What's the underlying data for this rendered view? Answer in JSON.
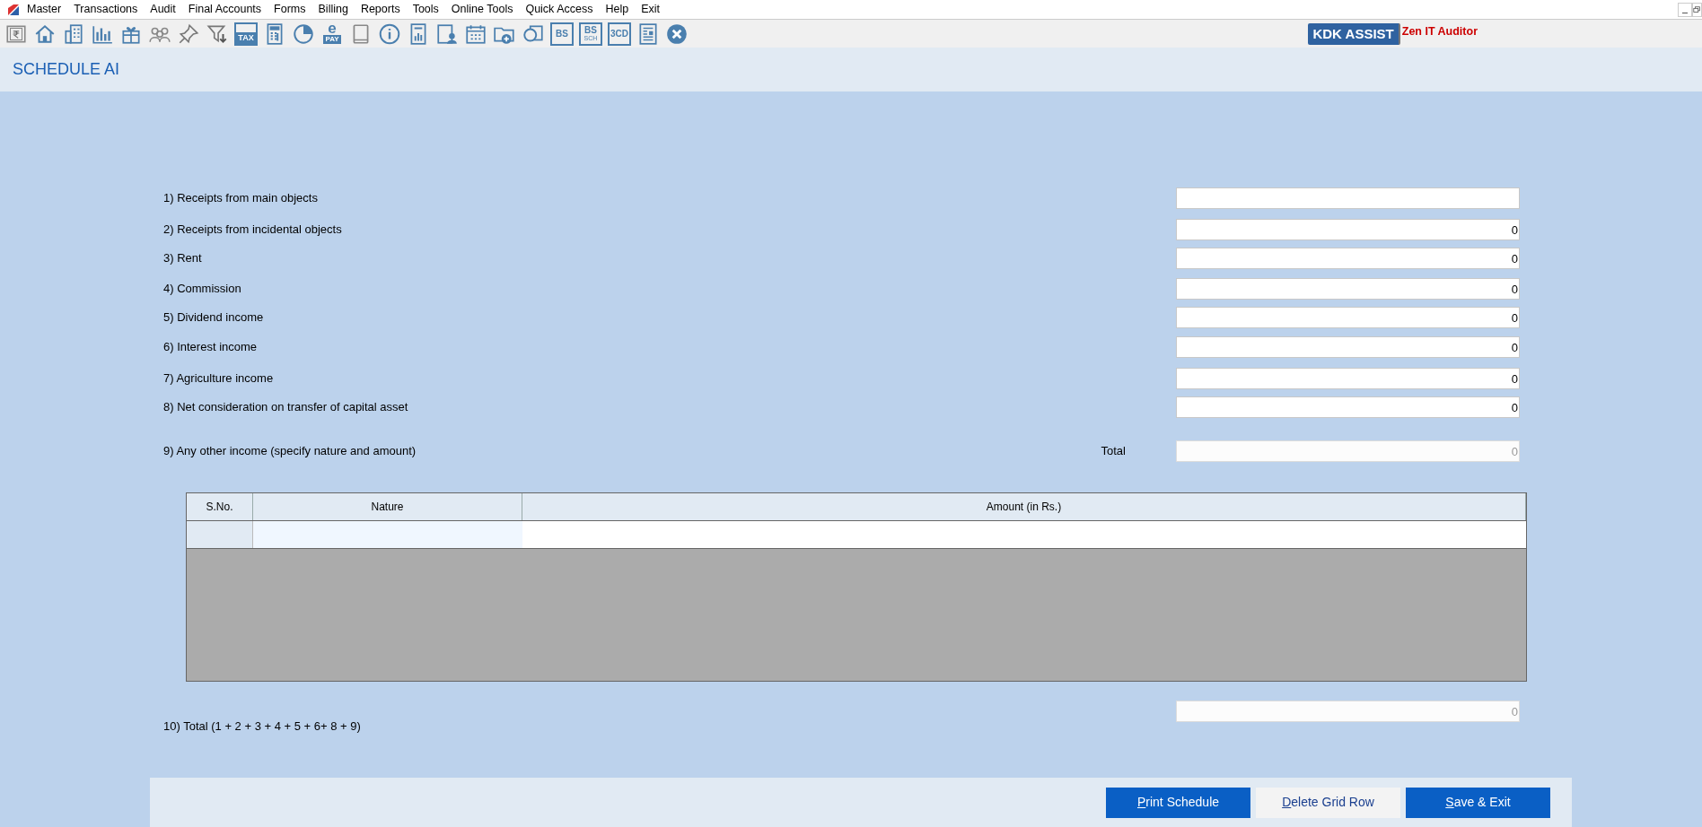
{
  "menu": [
    "Master",
    "Transactions",
    "Audit",
    "Final Accounts",
    "Forms",
    "Billing",
    "Reports",
    "Tools",
    "Online Tools",
    "Quick Access",
    "Help",
    "Exit"
  ],
  "toolbar": [
    {
      "kind": "rupee"
    },
    {
      "kind": "home"
    },
    {
      "kind": "building"
    },
    {
      "kind": "barchart"
    },
    {
      "kind": "gift"
    },
    {
      "kind": "people"
    },
    {
      "kind": "pin"
    },
    {
      "kind": "filter"
    },
    {
      "kind": "tax",
      "label": "TAX"
    },
    {
      "kind": "calculator"
    },
    {
      "kind": "pie"
    },
    {
      "kind": "epay",
      "label": "e",
      "sublabel": "PAY"
    },
    {
      "kind": "book"
    },
    {
      "kind": "info"
    },
    {
      "kind": "report"
    },
    {
      "kind": "userdoc"
    },
    {
      "kind": "calendar"
    },
    {
      "kind": "folderplus"
    },
    {
      "kind": "circlesquare"
    },
    {
      "kind": "tag",
      "label": "BS"
    },
    {
      "kind": "tagsub",
      "label": "BS",
      "sublabel": "SCH"
    },
    {
      "kind": "tag",
      "label": "3CD"
    },
    {
      "kind": "newspaper"
    },
    {
      "kind": "close"
    }
  ],
  "assist_button": "KDK ASSIST",
  "app_name": "Zen IT Auditor",
  "title": "SCHEDULE AI",
  "items": [
    {
      "label": "1) Receipts from main objects",
      "value": "",
      "disabled": false
    },
    {
      "label": "2) Receipts from incidental objects",
      "value": "0",
      "disabled": false
    },
    {
      "label": "3) Rent",
      "value": "0",
      "disabled": false
    },
    {
      "label": "4) Commission",
      "value": "0",
      "disabled": false
    },
    {
      "label": "5) Dividend income",
      "value": "0",
      "disabled": false
    },
    {
      "label": "6) Interest income",
      "value": "0",
      "disabled": false
    },
    {
      "label": "7) Agriculture income",
      "value": "0",
      "disabled": false
    },
    {
      "label": "8) Net consideration on transfer of capital asset",
      "value": "0",
      "disabled": false
    }
  ],
  "other_income": {
    "label": "9) Any other income (specify nature and amount)",
    "total_label": "Total",
    "value": "0",
    "disabled": true
  },
  "grid": {
    "columns": [
      "S.No.",
      "Nature",
      "Amount (in Rs.)"
    ]
  },
  "grand_total": {
    "label": "10) Total (1 + 2 + 3 + 4 + 5 + 6+ 8 + 9)",
    "value": "0",
    "disabled": true
  },
  "buttons": [
    {
      "label": "Print Schedule",
      "kind": "primary"
    },
    {
      "label": "Delete Grid Row",
      "kind": "secondary"
    },
    {
      "label": "Save & Exit",
      "kind": "primary"
    }
  ]
}
